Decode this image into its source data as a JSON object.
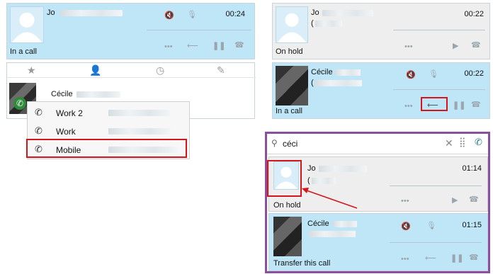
{
  "panel_a": {
    "contact_name": "Jo",
    "timer": "00:24",
    "status": "In a call",
    "icons": [
      "mute-speaker-icon",
      "microphone-icon",
      "more-dots-icon",
      "transfer-icon",
      "pause-icon",
      "hangup-icon"
    ]
  },
  "panel_b": {
    "tabs": [
      "star-icon",
      "person-icon",
      "clock-icon",
      "wrench-icon"
    ],
    "contact_name": "Cécile",
    "menu_items": [
      {
        "label": "Work 2",
        "icon": "phone-icon"
      },
      {
        "label": "Work",
        "icon": "phone-icon"
      },
      {
        "label": "Mobile",
        "icon": "phone-icon"
      }
    ]
  },
  "panel_c": {
    "call1": {
      "contact_name": "Jo",
      "sub": "(",
      "timer": "00:22",
      "status": "On hold"
    },
    "call2": {
      "contact_name": "Cécile",
      "sub": "(",
      "timer": "00:22",
      "status": "In a call"
    }
  },
  "panel_d": {
    "search_value": "céci",
    "call1": {
      "contact_name": "Jo",
      "sub": "(",
      "timer": "01:14",
      "status": "On hold"
    },
    "call2": {
      "contact_name": "Cécile",
      "timer": "01:15",
      "status": "Transfer this call"
    }
  },
  "colors": {
    "call_blue": "#bfe6f7",
    "hold_grey": "#eeeeee",
    "highlight_red": "#d5141b",
    "frame_purple": "#8a4f9e"
  }
}
